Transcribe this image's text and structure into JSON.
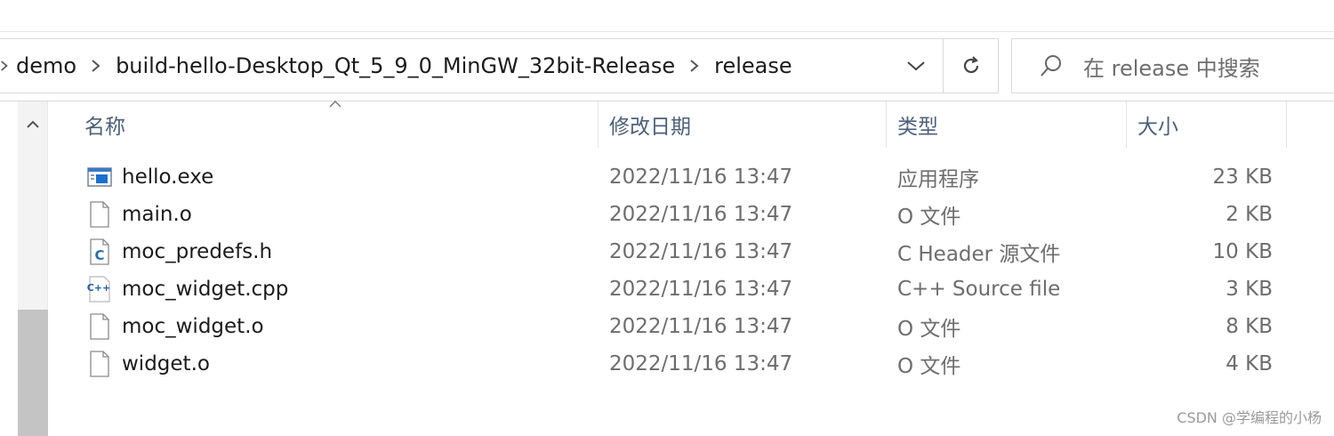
{
  "address_bar": {
    "crumbs": [
      "demo",
      "build-hello-Desktop_Qt_5_9_0_MinGW_32bit-Release",
      "release"
    ]
  },
  "search": {
    "placeholder": "在 release 中搜索"
  },
  "columns": {
    "name": "名称",
    "date": "修改日期",
    "type": "类型",
    "size": "大小"
  },
  "files": [
    {
      "name": "hello.exe",
      "date": "2022/11/16 13:47",
      "type": "应用程序",
      "size": "23 KB",
      "icon": "exe-icon"
    },
    {
      "name": "main.o",
      "date": "2022/11/16 13:47",
      "type": "O 文件",
      "size": "2 KB",
      "icon": "blank-file-icon"
    },
    {
      "name": "moc_predefs.h",
      "date": "2022/11/16 13:47",
      "type": "C Header 源文件",
      "size": "10 KB",
      "icon": "c-header-icon"
    },
    {
      "name": "moc_widget.cpp",
      "date": "2022/11/16 13:47",
      "type": "C++ Source file",
      "size": "3 KB",
      "icon": "cpp-file-icon"
    },
    {
      "name": "moc_widget.o",
      "date": "2022/11/16 13:47",
      "type": "O 文件",
      "size": "8 KB",
      "icon": "blank-file-icon"
    },
    {
      "name": "widget.o",
      "date": "2022/11/16 13:47",
      "type": "O 文件",
      "size": "4 KB",
      "icon": "blank-file-icon"
    }
  ],
  "watermark": "CSDN @学编程的小杨",
  "colors": {
    "header_text": "#4c607a",
    "secondary_text": "#6d6d6d",
    "border": "#d9d9d9"
  }
}
